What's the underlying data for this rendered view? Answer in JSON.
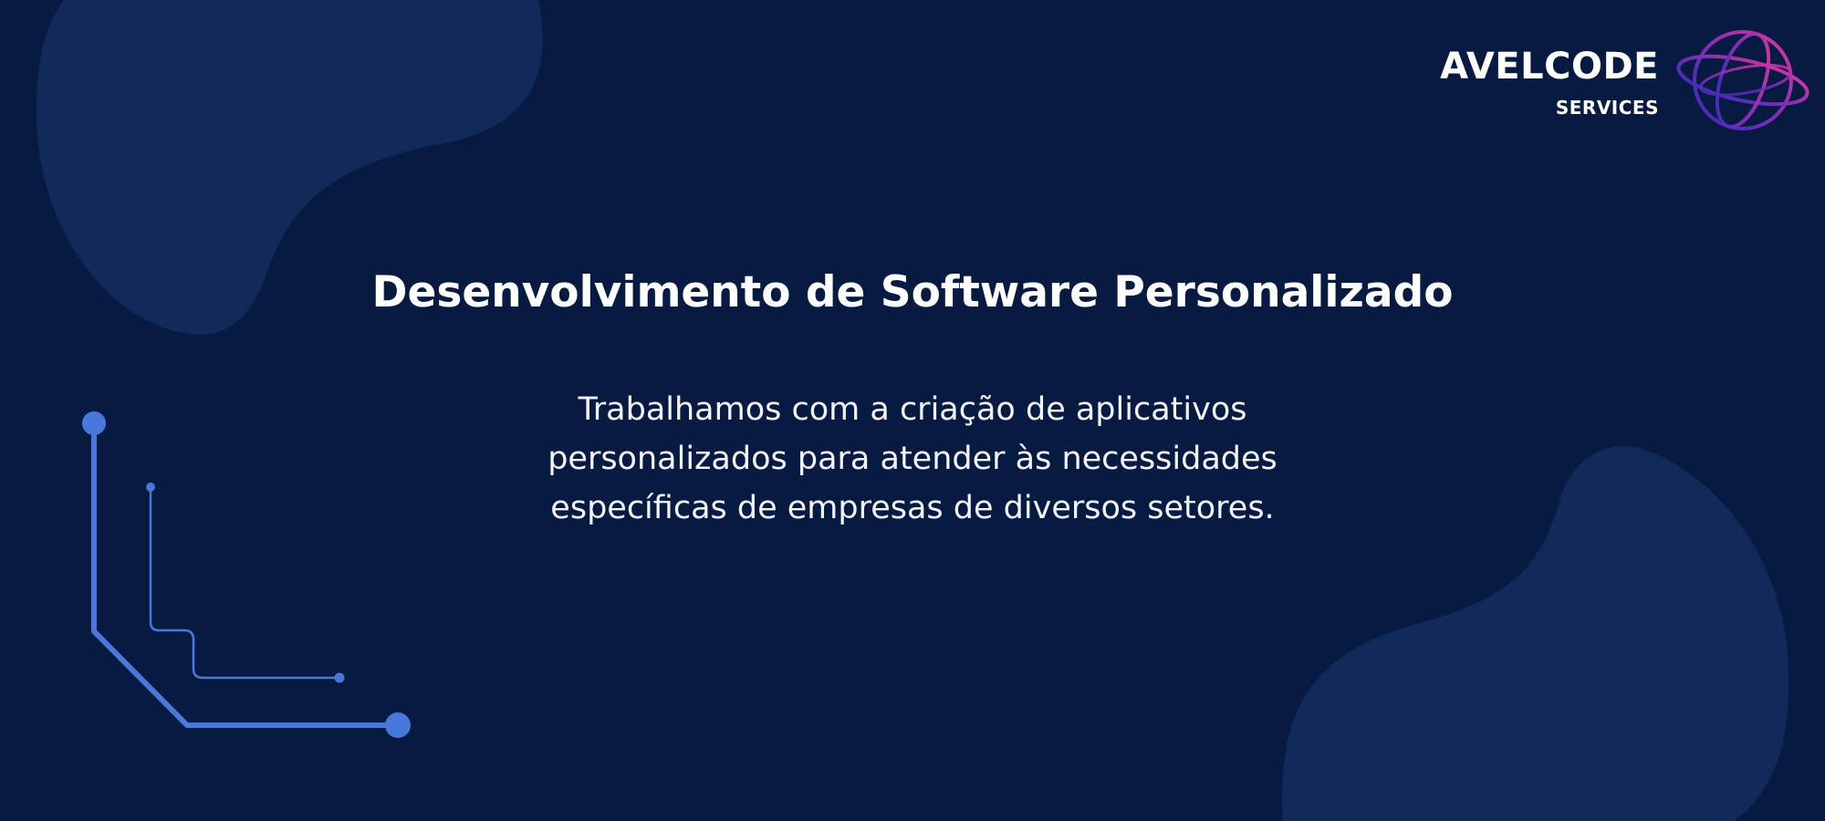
{
  "brand": {
    "name": "AVELCODE",
    "subtitle": "SERVICES",
    "logo_icon": "globe-icon",
    "gradient_start": "#2f2bb6",
    "gradient_end": "#e3359b"
  },
  "hero": {
    "title": "Desenvolvimento de Software Personalizado",
    "description_lines": [
      "Trabalhamos com a criação de aplicativos",
      "personalizados para atender às necessidades",
      "específicas de empresas de diversos setores."
    ]
  },
  "decor": {
    "background_color": "#071b42",
    "blob_color": "#112a59",
    "circuit_color": "#4a77db",
    "circuit_icon": "circuit-line-icon"
  }
}
